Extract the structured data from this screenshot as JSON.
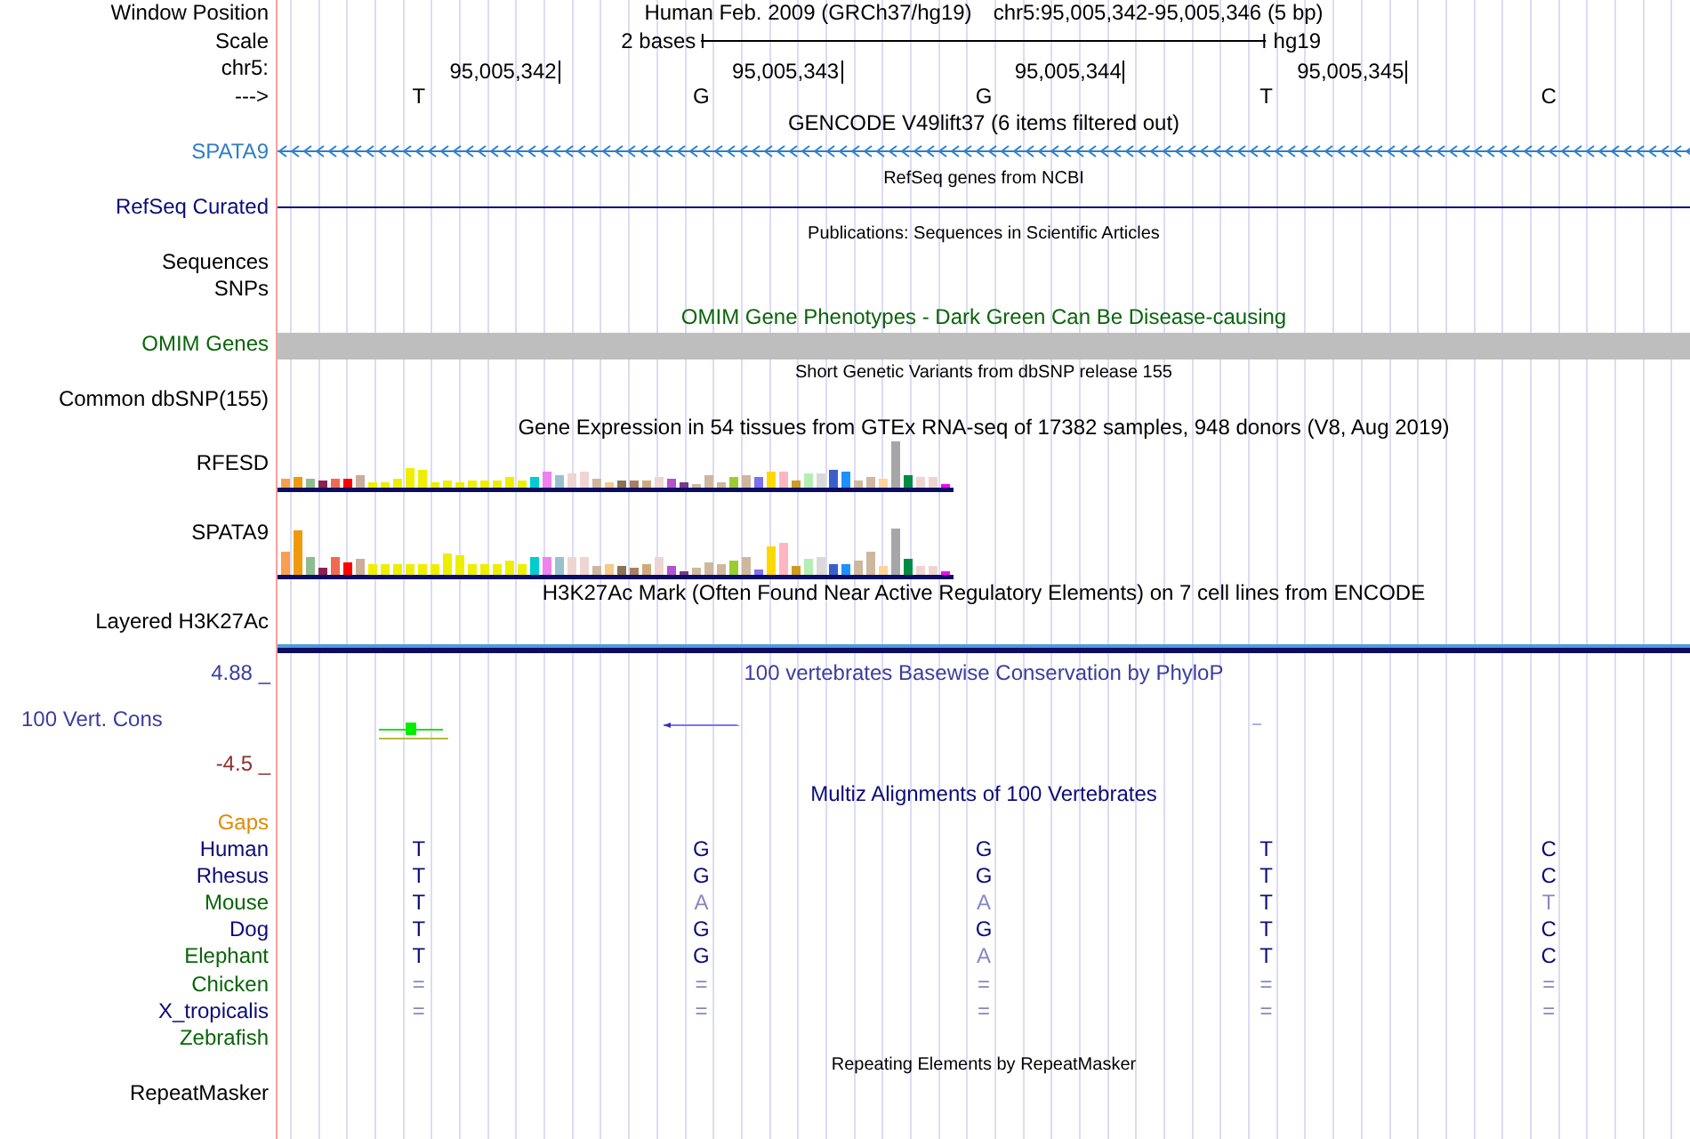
{
  "header": {
    "position_label": "Window Position",
    "assembly": "Human Feb. 2009 (GRCh37/hg19)",
    "position": "chr5:95,005,342-95,005,346 (5 bp)",
    "scale_label": "Scale",
    "scale_text": "2 bases",
    "scale_assembly": "hg19",
    "chrom_label": "chr5:",
    "ticks": [
      "95,005,342",
      "95,005,343",
      "95,005,344",
      "95,005,345"
    ],
    "strand_label": "--->",
    "bases": [
      "T",
      "G",
      "G",
      "T",
      "C"
    ]
  },
  "tracks": [
    {
      "kind": "gene",
      "title": {
        "text": "GENCODE V49lift37 (6 items filtered out)",
        "color": "#000000"
      },
      "labels": [
        {
          "text": "SPATA9",
          "color": "#2f7ec8"
        }
      ]
    },
    {
      "kind": "line",
      "title": {
        "text": "RefSeq genes from NCBI",
        "color": "#000000"
      },
      "labels": [
        {
          "text": "RefSeq Curated",
          "color": "#0c0c78"
        }
      ]
    },
    {
      "kind": "plain",
      "title": {
        "text": "Publications: Sequences in Scientific Articles",
        "color": "#000000"
      },
      "labels": [
        {
          "text": "Sequences",
          "color": "#000000"
        },
        {
          "text": "SNPs",
          "color": "#000000"
        }
      ]
    },
    {
      "kind": "band",
      "title": {
        "text": "OMIM Gene Phenotypes - Dark Green Can Be Disease-causing",
        "color": "#0a640a"
      },
      "labels": [
        {
          "text": "OMIM Genes",
          "color": "#0a640a"
        }
      ]
    },
    {
      "kind": "plain",
      "title": {
        "text": "Short Genetic Variants from dbSNP release 155",
        "color": "#000000"
      },
      "labels": [
        {
          "text": "Common dbSNP(155)",
          "color": "#000000"
        }
      ]
    },
    {
      "kind": "expression",
      "title": {
        "text": "Gene Expression in 54 tissues from GTEx RNA-seq of 17382 samples, 948 donors (V8, Aug 2019)",
        "color": "#000000"
      },
      "labels": [
        {
          "text": "RFESD",
          "color": "#000000"
        },
        {
          "text": "SPATA9",
          "color": "#000000"
        }
      ]
    },
    {
      "kind": "signal",
      "title": {
        "text": "H3K27Ac Mark (Often Found Near Active Regulatory Elements) on 7 cell lines from ENCODE",
        "color": "#000000"
      },
      "labels": [
        {
          "text": "Layered H3K27Ac",
          "color": "#000000"
        }
      ]
    },
    {
      "kind": "conservation",
      "title": {
        "text": "100 vertebrates Basewise Conservation by PhyloP",
        "color": "#3c3ca0"
      },
      "labels": [
        {
          "text": "4.88 _",
          "color": "#3c3ca0"
        },
        {
          "text": "100 Vert. Cons",
          "color": "#3c3ca0"
        },
        {
          "text": "-4.5 _",
          "color": "#8b3030"
        }
      ]
    },
    {
      "kind": "alignment",
      "title": {
        "text": "Multiz Alignments of 100 Vertebrates",
        "color": "#0c0c78"
      },
      "labels": [
        {
          "text": "Gaps",
          "color": "#e08a00"
        },
        {
          "text": "Human",
          "color": "#0c0c78",
          "bases": [
            {
              "base": "T",
              "match": true
            },
            {
              "base": "G",
              "match": true
            },
            {
              "base": "G",
              "match": true
            },
            {
              "base": "T",
              "match": true
            },
            {
              "base": "C",
              "match": true
            }
          ]
        },
        {
          "text": "Rhesus",
          "color": "#0c0c78",
          "bases": [
            {
              "base": "T",
              "match": true
            },
            {
              "base": "G",
              "match": true
            },
            {
              "base": "G",
              "match": true
            },
            {
              "base": "T",
              "match": true
            },
            {
              "base": "C",
              "match": true
            }
          ]
        },
        {
          "text": "Mouse",
          "color": "#0a640a",
          "bases": [
            {
              "base": "T",
              "match": true
            },
            {
              "base": "A",
              "match": false
            },
            {
              "base": "A",
              "match": false
            },
            {
              "base": "T",
              "match": true
            },
            {
              "base": "T",
              "match": false
            }
          ]
        },
        {
          "text": "Dog",
          "color": "#0c0c78",
          "bases": [
            {
              "base": "T",
              "match": true
            },
            {
              "base": "G",
              "match": true
            },
            {
              "base": "G",
              "match": true
            },
            {
              "base": "T",
              "match": true
            },
            {
              "base": "C",
              "match": true
            }
          ]
        },
        {
          "text": "Elephant",
          "color": "#0a640a",
          "bases": [
            {
              "base": "T",
              "match": true
            },
            {
              "base": "G",
              "match": true
            },
            {
              "base": "A",
              "match": false
            },
            {
              "base": "T",
              "match": true
            },
            {
              "base": "C",
              "match": true
            }
          ]
        },
        {
          "text": "Chicken",
          "color": "#0a640a",
          "bases": [
            {
              "base": "=",
              "match": false
            },
            {
              "base": "=",
              "match": false
            },
            {
              "base": "=",
              "match": false
            },
            {
              "base": "=",
              "match": false
            },
            {
              "base": "=",
              "match": false
            }
          ]
        },
        {
          "text": "X_tropicalis",
          "color": "#0c0c78",
          "bases": [
            {
              "base": "=",
              "match": false
            },
            {
              "base": "=",
              "match": false
            },
            {
              "base": "=",
              "match": false
            },
            {
              "base": "=",
              "match": false
            },
            {
              "base": "=",
              "match": false
            }
          ]
        },
        {
          "text": "Zebrafish",
          "color": "#0a640a"
        }
      ]
    },
    {
      "kind": "plain",
      "title": {
        "text": "Repeating Elements by RepeatMasker",
        "color": "#000000"
      },
      "labels": [
        {
          "text": "RepeatMasker",
          "color": "#000000"
        }
      ]
    }
  ]
}
